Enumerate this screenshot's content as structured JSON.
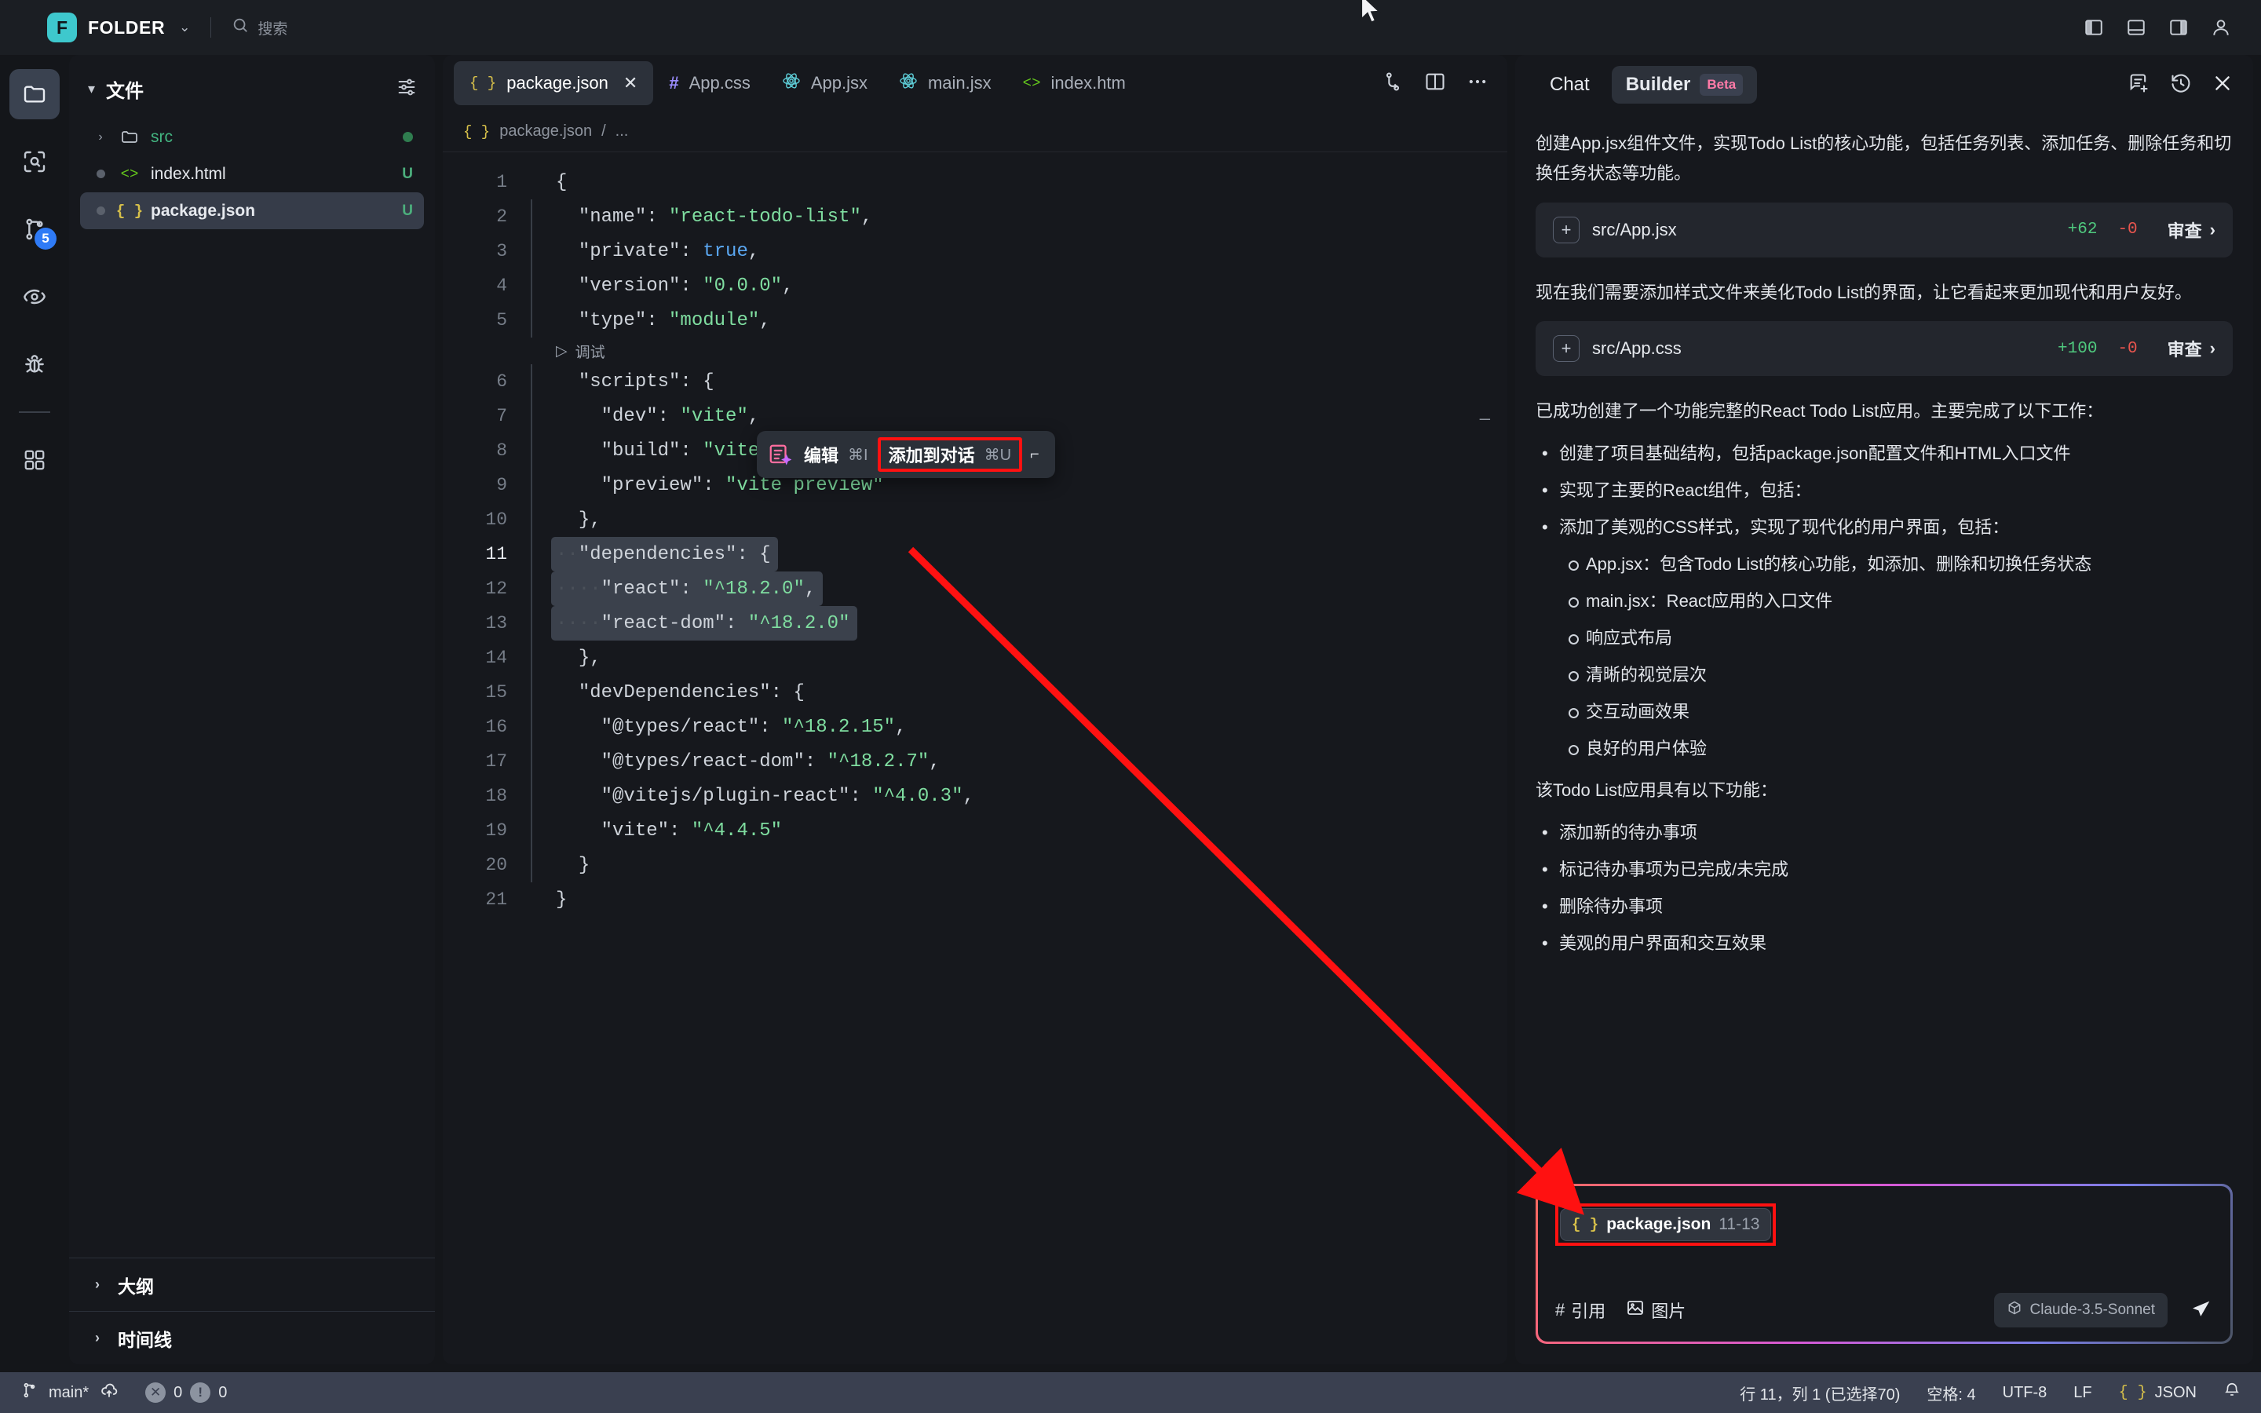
{
  "titlebar": {
    "logo_letter": "F",
    "app_name": "FOLDER",
    "dropdown_icon": "chevron-down-icon",
    "search_placeholder": "搜索",
    "search_icon": "search-icon",
    "right_icons": [
      "panel-left-icon",
      "panel-bottom-icon",
      "panel-right-icon",
      "account-icon"
    ]
  },
  "activitybar": {
    "items": [
      {
        "name": "explorer",
        "icon": "folder-icon",
        "active": true,
        "badge": ""
      },
      {
        "name": "search",
        "icon": "search-scope-icon",
        "active": false,
        "badge": ""
      },
      {
        "name": "source-control",
        "icon": "git-branch-icon",
        "active": false,
        "badge": "5"
      },
      {
        "name": "watch",
        "icon": "eye-icon",
        "active": false,
        "badge": ""
      },
      {
        "name": "debug",
        "icon": "bug-icon",
        "active": false,
        "badge": ""
      },
      {
        "name": "extensions",
        "icon": "grid-icon",
        "active": false,
        "badge": ""
      }
    ]
  },
  "explorer": {
    "title": "文件",
    "caret": "▾",
    "tools_icon": "filter-settings-icon",
    "files": [
      {
        "name": "src",
        "icon": "folder-icon",
        "type": "folder",
        "caret": "›",
        "status": "",
        "dot": "green"
      },
      {
        "name": "index.html",
        "icon": "html-icon",
        "type": "file",
        "caret": "",
        "status": "U",
        "dot": "gray"
      },
      {
        "name": "package.json",
        "icon": "json-icon",
        "type": "file",
        "caret": "",
        "status": "U",
        "dot": "gray",
        "selected": true
      }
    ],
    "sections": [
      {
        "label": "大纲",
        "caret": "›"
      },
      {
        "label": "时间线",
        "caret": "›"
      }
    ]
  },
  "editor": {
    "tabs": [
      {
        "label": "package.json",
        "icon": "json-icon",
        "active": true,
        "close": "✕"
      },
      {
        "label": "App.css",
        "icon": "css-icon",
        "active": false
      },
      {
        "label": "App.jsx",
        "icon": "react-icon",
        "active": false
      },
      {
        "label": "main.jsx",
        "icon": "react-icon",
        "active": false
      },
      {
        "label": "index.htm",
        "icon": "html-icon",
        "active": false
      }
    ],
    "tab_actions": [
      "source-control-icon",
      "split-editor-icon",
      "more-actions-icon"
    ],
    "breadcrumb": {
      "icon": "json-icon",
      "file": "package.json",
      "sep": "/",
      "tail": "..."
    },
    "codelens": {
      "icon": "run-icon",
      "label": "调试"
    },
    "fold_marker": "—",
    "lines": [
      {
        "n": "1",
        "indent": 0,
        "guide": false,
        "tokens": [
          {
            "t": "{",
            "c": "key"
          }
        ]
      },
      {
        "n": "2",
        "indent": 1,
        "guide": true,
        "tokens": [
          {
            "t": "\"name\": ",
            "c": "key"
          },
          {
            "t": "\"react-todo-list\"",
            "c": "str"
          },
          {
            "t": ",",
            "c": "key"
          }
        ]
      },
      {
        "n": "3",
        "indent": 1,
        "guide": true,
        "tokens": [
          {
            "t": "\"private\": ",
            "c": "key"
          },
          {
            "t": "true",
            "c": "bool"
          },
          {
            "t": ",",
            "c": "key"
          }
        ]
      },
      {
        "n": "4",
        "indent": 1,
        "guide": true,
        "tokens": [
          {
            "t": "\"version\": ",
            "c": "key"
          },
          {
            "t": "\"0.0.0\"",
            "c": "str"
          },
          {
            "t": ",",
            "c": "key"
          }
        ]
      },
      {
        "n": "5",
        "indent": 1,
        "guide": true,
        "tokens": [
          {
            "t": "\"type\": ",
            "c": "key"
          },
          {
            "t": "\"module\"",
            "c": "str"
          },
          {
            "t": ",",
            "c": "key"
          }
        ]
      },
      {
        "n": "6",
        "indent": 1,
        "guide": true,
        "tokens": [
          {
            "t": "\"scripts\": {",
            "c": "key"
          }
        ]
      },
      {
        "n": "7",
        "indent": 2,
        "guide": true,
        "tokens": [
          {
            "t": "\"dev\": ",
            "c": "key"
          },
          {
            "t": "\"vite\"",
            "c": "str"
          },
          {
            "t": ",",
            "c": "key"
          }
        ]
      },
      {
        "n": "8",
        "indent": 2,
        "guide": true,
        "tokens": [
          {
            "t": "\"build\": ",
            "c": "key"
          },
          {
            "t": "\"vite build\"",
            "c": "str"
          },
          {
            "t": ",",
            "c": "key"
          }
        ]
      },
      {
        "n": "9",
        "indent": 2,
        "guide": true,
        "tokens": [
          {
            "t": "\"preview\": ",
            "c": "key"
          },
          {
            "t": "\"vite preview\"",
            "c": "str"
          }
        ]
      },
      {
        "n": "10",
        "indent": 1,
        "guide": true,
        "tokens": [
          {
            "t": "},",
            "c": "key"
          }
        ]
      },
      {
        "n": "11",
        "indent": 1,
        "guide": true,
        "current": true,
        "selected": true,
        "tokens": [
          {
            "t": "\"dependencies\": {",
            "c": "key"
          }
        ]
      },
      {
        "n": "12",
        "indent": 2,
        "guide": true,
        "selected": true,
        "tokens": [
          {
            "t": "\"react\": ",
            "c": "key"
          },
          {
            "t": "\"^18.2.0\"",
            "c": "str"
          },
          {
            "t": ",",
            "c": "key"
          }
        ]
      },
      {
        "n": "13",
        "indent": 2,
        "guide": true,
        "selected": true,
        "tokens": [
          {
            "t": "\"react-dom\": ",
            "c": "key"
          },
          {
            "t": "\"^18.2.0\"",
            "c": "str"
          }
        ]
      },
      {
        "n": "14",
        "indent": 1,
        "guide": true,
        "tokens": [
          {
            "t": "},",
            "c": "key"
          }
        ]
      },
      {
        "n": "15",
        "indent": 1,
        "guide": true,
        "tokens": [
          {
            "t": "\"devDependencies\": {",
            "c": "key"
          }
        ]
      },
      {
        "n": "16",
        "indent": 2,
        "guide": true,
        "tokens": [
          {
            "t": "\"@types/react\": ",
            "c": "key"
          },
          {
            "t": "\"^18.2.15\"",
            "c": "str"
          },
          {
            "t": ",",
            "c": "key"
          }
        ]
      },
      {
        "n": "17",
        "indent": 2,
        "guide": true,
        "tokens": [
          {
            "t": "\"@types/react-dom\": ",
            "c": "key"
          },
          {
            "t": "\"^18.2.7\"",
            "c": "str"
          },
          {
            "t": ",",
            "c": "key"
          }
        ]
      },
      {
        "n": "18",
        "indent": 2,
        "guide": true,
        "tokens": [
          {
            "t": "\"@vitejs/plugin-react\": ",
            "c": "key"
          },
          {
            "t": "\"^4.0.3\"",
            "c": "str"
          },
          {
            "t": ",",
            "c": "key"
          }
        ]
      },
      {
        "n": "19",
        "indent": 2,
        "guide": true,
        "tokens": [
          {
            "t": "\"vite\": ",
            "c": "key"
          },
          {
            "t": "\"^4.4.5\"",
            "c": "str"
          }
        ]
      },
      {
        "n": "20",
        "indent": 1,
        "guide": true,
        "tokens": [
          {
            "t": "}",
            "c": "key"
          }
        ]
      },
      {
        "n": "21",
        "indent": 0,
        "guide": false,
        "tokens": [
          {
            "t": "}",
            "c": "key"
          }
        ]
      }
    ]
  },
  "context_menu": {
    "icon": "ai-edit-icon",
    "edit_label": "编辑",
    "edit_shortcut": "⌘I",
    "add_label": "添加到对话",
    "add_shortcut": "⌘U",
    "corner_icon": "resize-corner-icon"
  },
  "chat": {
    "tabs": [
      {
        "label": "Chat",
        "active": false
      },
      {
        "label": "Builder",
        "active": true,
        "badge": "Beta"
      }
    ],
    "head_icons": [
      "new-chat-icon",
      "history-icon",
      "close-icon"
    ],
    "messages": [
      {
        "type": "paragraph",
        "text": "创建App.jsx组件文件，实现Todo List的核心功能，包括任务列表、添加任务、删除任务和切换任务状态等功能。"
      },
      {
        "type": "file_card",
        "path": "src/App.jsx",
        "added": "+62",
        "removed": "-0",
        "review": "审查",
        "chevron": "›"
      },
      {
        "type": "paragraph",
        "text": "现在我们需要添加样式文件来美化Todo List的界面，让它看起来更加现代和用户友好。"
      },
      {
        "type": "file_card",
        "path": "src/App.css",
        "added": "+100",
        "removed": "-0",
        "review": "审查",
        "chevron": "›"
      },
      {
        "type": "paragraph",
        "text": "已成功创建了一个功能完整的React Todo List应用。主要完成了以下工作："
      }
    ],
    "summary_bullets": [
      {
        "level": 1,
        "text": "创建了项目基础结构，包括package.json配置文件和HTML入口文件"
      },
      {
        "level": 1,
        "text": "实现了主要的React组件，包括："
      },
      {
        "level": 2,
        "text": "App.jsx：包含Todo List的核心功能，如添加、删除和切换任务状态"
      },
      {
        "level": 2,
        "text": "main.jsx：React应用的入口文件"
      },
      {
        "level": 1,
        "text": "添加了美观的CSS样式，实现了现代化的用户界面，包括："
      },
      {
        "level": 2,
        "text": "响应式布局"
      },
      {
        "level": 2,
        "text": "清晰的视觉层次"
      },
      {
        "level": 2,
        "text": "交互动画效果"
      },
      {
        "level": 2,
        "text": "良好的用户体验"
      }
    ],
    "features_title": "该Todo List应用具有以下功能：",
    "features": [
      "添加新的待办事项",
      "标记待办事项为已完成/未完成",
      "删除待办事项",
      "美观的用户界面和交互效果"
    ],
    "composer": {
      "chip_icon": "json-icon",
      "chip_file": "package.json",
      "chip_range": "11-13",
      "reference_icon": "hash-icon",
      "reference_label": "引用",
      "image_icon": "image-icon",
      "image_label": "图片",
      "model_icon": "cube-icon",
      "model_label": "Claude-3.5-Sonnet",
      "send_icon": "send-icon"
    }
  },
  "statusbar": {
    "branch_icon": "git-branch-icon",
    "branch": "main*",
    "sync_icon": "cloud-sync-icon",
    "error_icon": "error-icon",
    "errors": "0",
    "warning_icon": "warning-icon",
    "warnings": "0",
    "cursor_position": "行 11，列 1 (已选择70)",
    "indentation": "空格: 4",
    "encoding": "UTF-8",
    "eol": "LF",
    "language_icon": "json-icon",
    "language": "JSON",
    "bell_icon": "bell-icon"
  },
  "annotation": {
    "arrow_color": "#ff1111",
    "highlight_color": "#ff1111"
  }
}
